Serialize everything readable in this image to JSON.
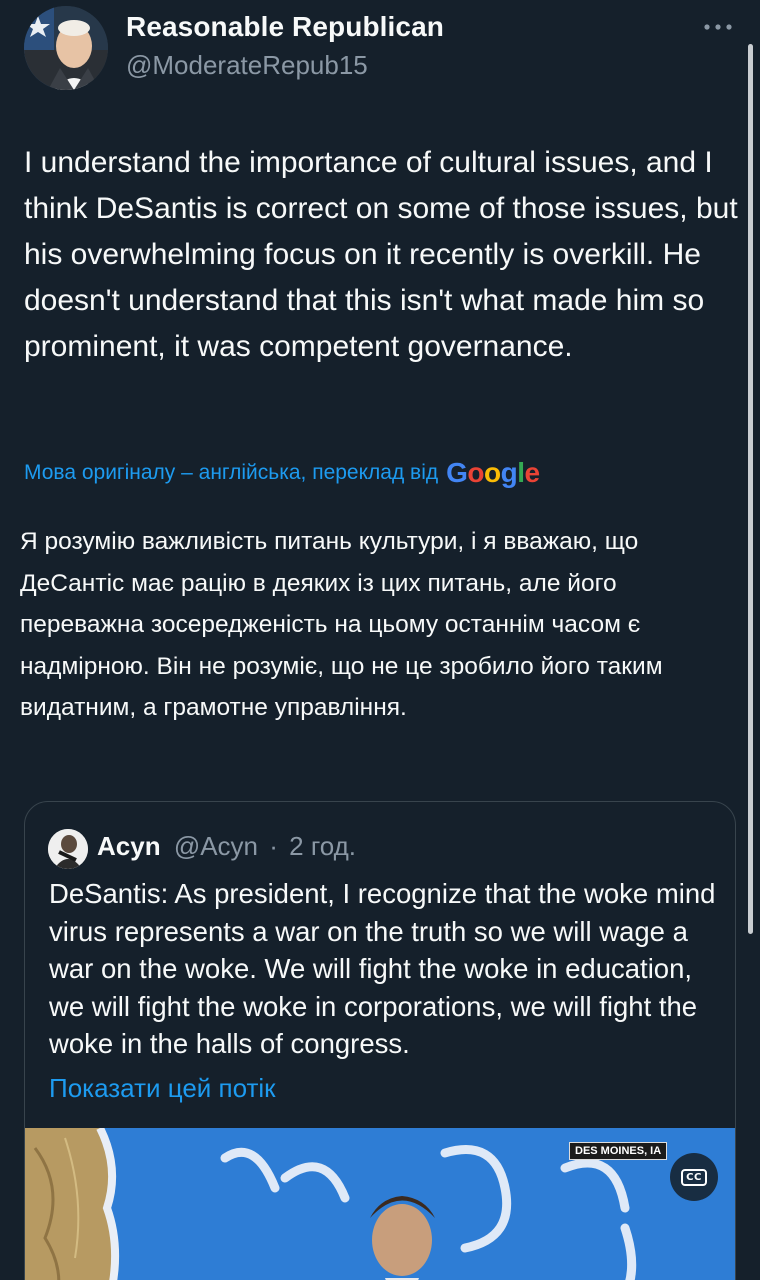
{
  "author": {
    "name": "Reasonable Republican",
    "handle": "@ModerateRepub15"
  },
  "tweet": {
    "text": "I understand the importance of cultural issues, and I think DeSantis is correct on some of those issues, but his overwhelming focus on it recently is overkill. He doesn't understand that this isn't what made him so prominent, it was competent governance."
  },
  "translation": {
    "note": "Мова оригіналу – англійська, переклад від",
    "provider": "Google",
    "text": "Я розумію важливість питань культури, і я вважаю, що ДеСантіс має рацію в деяких із цих питань, але його переважна зосередженість на цьому останнім часом є надмірною. Він не розуміє, що не це зробило його таким видатним, а грамотне управління."
  },
  "quote": {
    "name": "Acyn",
    "handle": "@Acyn",
    "separator": "·",
    "time": "2 год.",
    "text": "DeSantis: As president, I recognize that the woke mind virus represents a war on the truth so we will wage a war on the woke. We will fight the woke in education, we will fight the woke in corporations, we will fight the woke in the halls of congress.",
    "show_thread": "Показати цей потік",
    "media": {
      "location_badge": "DES MOINES, IA",
      "cc_label": "CC"
    }
  },
  "icons": {
    "more": "more-horizontal-icon",
    "cc": "closed-captions-icon"
  },
  "colors": {
    "background": "#15202b",
    "link": "#1d9bf0",
    "secondary_text": "#8b98a5",
    "border": "#38444d"
  }
}
